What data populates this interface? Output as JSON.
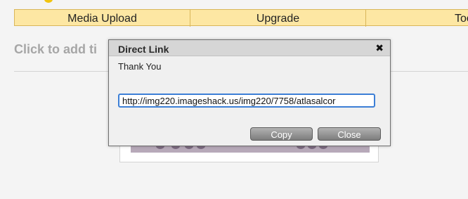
{
  "nav": {
    "items": [
      {
        "label": "Media Upload"
      },
      {
        "label": "Upgrade"
      },
      {
        "label": "Tools"
      }
    ]
  },
  "page": {
    "title_visible": "Click to add ti"
  },
  "modal": {
    "title": "Direct Link",
    "close_glyph": "✖",
    "message": "Thank You",
    "link_value": "http://img220.imageshack.us/img220/7758/atlasalcor",
    "copy_label": "Copy",
    "close_label": "Close"
  }
}
